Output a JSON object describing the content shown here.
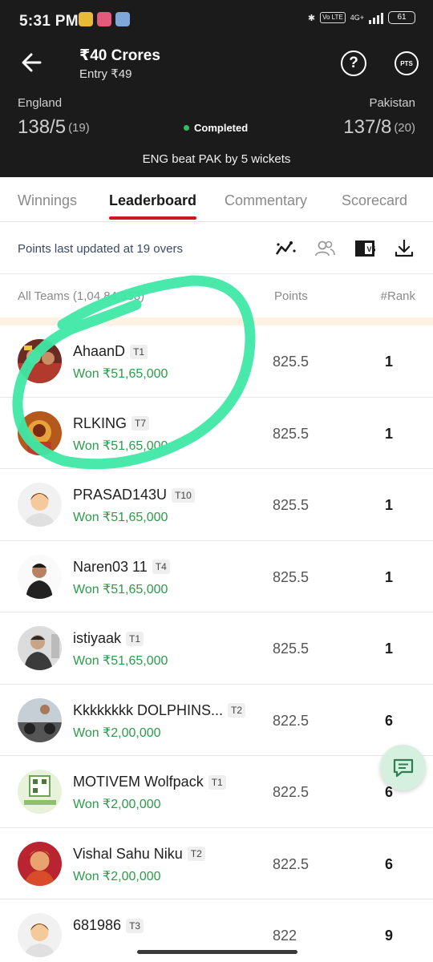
{
  "status_bar": {
    "time": "5:31 PM",
    "network_label": "4G+",
    "volte_label": "Vo LTE",
    "battery": "61"
  },
  "header": {
    "contest_title": "₹40 Crores",
    "entry": "Entry ₹49",
    "help_icon": "?",
    "pts_label": "PTS"
  },
  "match": {
    "team_left": {
      "name": "England",
      "score": "138/5",
      "overs": "(19)"
    },
    "team_right": {
      "name": "Pakistan",
      "score": "137/8",
      "overs": "(20)"
    },
    "status": "Completed",
    "result": "ENG beat PAK by 5 wickets"
  },
  "tabs": [
    {
      "label": "Winnings",
      "active": false
    },
    {
      "label": "Leaderboard",
      "active": true
    },
    {
      "label": "Commentary",
      "active": false
    },
    {
      "label": "Scorecard",
      "active": false
    }
  ],
  "info": {
    "updated_text": "Points last updated at 19 overs",
    "compare_badge": "V5"
  },
  "columns": {
    "teams": "All Teams (1,04,84,353)",
    "points": "Points",
    "rank": "#Rank"
  },
  "leaderboard": [
    {
      "name": "AhaanD",
      "team": "T1",
      "winning": "Won ₹51,65,000",
      "points": "825.5",
      "rank": "1"
    },
    {
      "name": "RLKING",
      "team": "T7",
      "winning": "Won ₹51,65,000",
      "points": "825.5",
      "rank": "1"
    },
    {
      "name": "PRASAD143U",
      "team": "T10",
      "winning": "Won ₹51,65,000",
      "points": "825.5",
      "rank": "1"
    },
    {
      "name": "Naren03 11",
      "team": "T4",
      "winning": "Won ₹51,65,000",
      "points": "825.5",
      "rank": "1"
    },
    {
      "name": "istiyaak",
      "team": "T1",
      "winning": "Won ₹51,65,000",
      "points": "825.5",
      "rank": "1"
    },
    {
      "name": "Kkkkkkkk DOLPHINS...",
      "team": "T2",
      "winning": "Won ₹2,00,000",
      "points": "822.5",
      "rank": "6"
    },
    {
      "name": "MOTIVEM Wolfpack",
      "team": "T1",
      "winning": "Won ₹2,00,000",
      "points": "822.5",
      "rank": "6"
    },
    {
      "name": "Vishal Sahu Niku",
      "team": "T2",
      "winning": "Won ₹2,00,000",
      "points": "822.5",
      "rank": "6"
    },
    {
      "name": "681986",
      "team": "T3",
      "winning": "",
      "points": "822",
      "rank": "9"
    }
  ],
  "colors": {
    "header_bg": "#1b1b1b",
    "active_tab_underline": "#d0161f",
    "winning_green": "#2c9b4a",
    "status_green": "#2fbf60",
    "highlight_scribble": "#3ee8a6",
    "chat_fab_bg": "#d6f0e0"
  },
  "icons": {
    "back": "arrow-left-icon",
    "help": "question-circle-icon",
    "pts": "pts-circle-icon",
    "trend": "trend-icon",
    "compare": "users-compare-icon",
    "versus": "versus-icon",
    "download": "download-icon",
    "chat": "chat-icon"
  }
}
